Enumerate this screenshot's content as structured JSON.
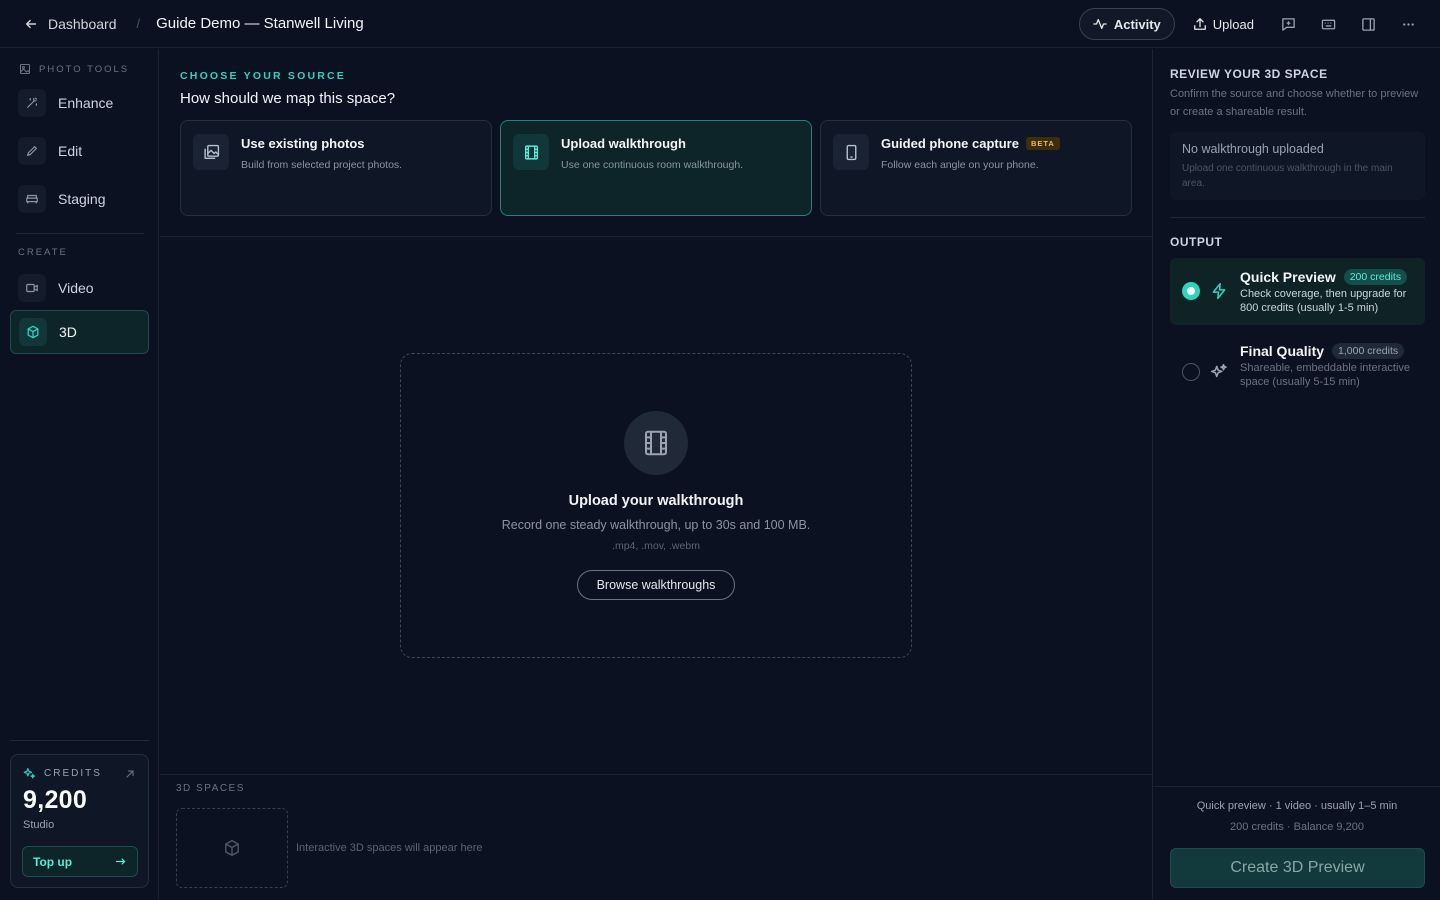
{
  "topbar": {
    "back_label": "Dashboard",
    "separator": "/",
    "title": "Guide Demo — Stanwell Living",
    "activity_label": "Activity",
    "upload_label": "Upload"
  },
  "sidebar": {
    "photo_tools_label": "PHOTO TOOLS",
    "photo_items": [
      {
        "label": "Enhance",
        "icon": "wand-icon"
      },
      {
        "label": "Edit",
        "icon": "pencil-icon"
      },
      {
        "label": "Staging",
        "icon": "sofa-icon"
      }
    ],
    "create_label": "CREATE",
    "create_items": [
      {
        "label": "Video",
        "icon": "video-icon"
      },
      {
        "label": "3D",
        "icon": "cube-icon",
        "active": true
      }
    ],
    "credits": {
      "label": "CREDITS",
      "value": "9,200",
      "plan": "Studio",
      "topup_label": "Top up"
    }
  },
  "main": {
    "eyebrow": "CHOOSE YOUR SOURCE",
    "question": "How should we map this space?",
    "sources": [
      {
        "title": "Use existing photos",
        "subtitle": "Build from selected project photos.",
        "icon": "photos-icon"
      },
      {
        "title": "Upload walkthrough",
        "subtitle": "Use one continuous room walkthrough.",
        "icon": "film-icon",
        "active": true
      },
      {
        "title": "Guided phone capture",
        "subtitle": "Follow each angle on your phone.",
        "icon": "phone-icon",
        "badge": "BETA"
      }
    ],
    "dropzone": {
      "title": "Upload your walkthrough",
      "subtitle": "Record one steady walkthrough, up to 30s and 100 MB.",
      "formats": ".mp4, .mov, .webm",
      "browse_label": "Browse walkthroughs"
    },
    "spaces": {
      "label": "3D SPACES",
      "empty_text": "Interactive 3D spaces will appear here"
    }
  },
  "review": {
    "title": "REVIEW YOUR 3D SPACE",
    "description": "Confirm the source and choose whether to preview or create a shareable result.",
    "info_title": "No walkthrough uploaded",
    "info_subtitle": "Upload one continuous walkthrough in the main area.",
    "output_label": "OUTPUT",
    "options": [
      {
        "title": "Quick Preview",
        "credits": "200 credits",
        "desc": "Check coverage, then upgrade for 800 credits (usually 1-5 min)",
        "selected": true,
        "icon": "bolt-icon"
      },
      {
        "title": "Final Quality",
        "credits": "1,000 credits",
        "desc": "Shareable, embeddable interactive space (usually 5-15 min)",
        "selected": false,
        "icon": "sparkle-icon"
      }
    ],
    "summary_line1": "Quick preview · 1 video · usually 1–5 min",
    "summary_line2": "200 credits · Balance 9,200",
    "create_label": "Create 3D Preview"
  },
  "colors": {
    "background": "#0b1120",
    "accent": "#2dd4bf",
    "beta": "#f5b942"
  }
}
